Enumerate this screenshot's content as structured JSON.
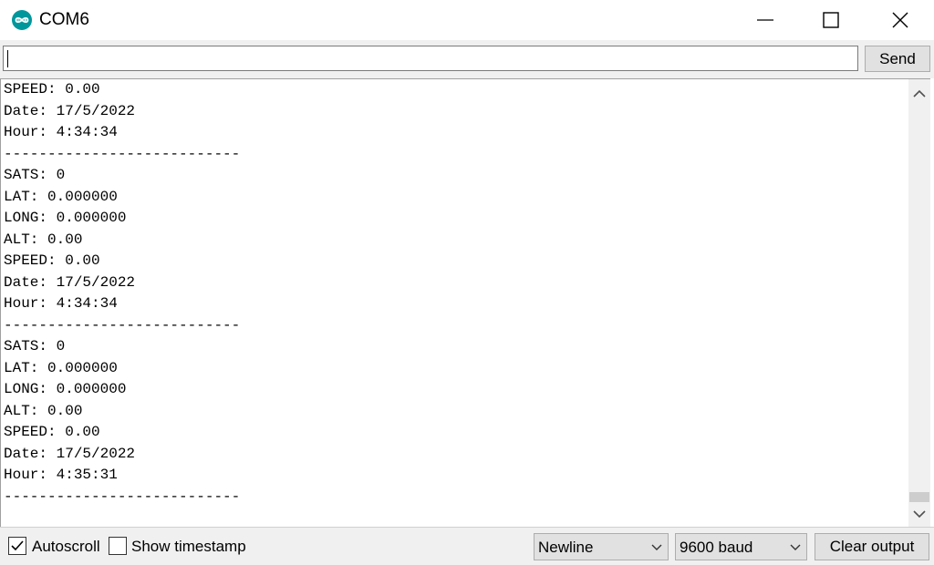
{
  "window": {
    "title": "COM6",
    "app_icon": "arduino-logo-icon",
    "controls": [
      "minimize-icon",
      "maximize-icon",
      "close-icon"
    ]
  },
  "input_bar": {
    "value": "",
    "send_label": "Send"
  },
  "output": {
    "lines": [
      "SPEED: 0.00",
      "Date: 17/5/2022",
      "Hour: 4:34:34",
      "---------------------------",
      "SATS: 0",
      "LAT: 0.000000",
      "LONG: 0.000000",
      "ALT: 0.00",
      "SPEED: 0.00",
      "Date: 17/5/2022",
      "Hour: 4:34:34",
      "---------------------------",
      "SATS: 0",
      "LAT: 0.000000",
      "LONG: 0.000000",
      "ALT: 0.00",
      "SPEED: 0.00",
      "Date: 17/5/2022",
      "Hour: 4:35:31",
      "---------------------------"
    ]
  },
  "bottom_bar": {
    "autoscroll": {
      "label": "Autoscroll",
      "checked": true
    },
    "timestamp": {
      "label": "Show timestamp",
      "checked": false
    },
    "line_ending": "Newline",
    "baud_rate": "9600 baud",
    "clear_label": "Clear output"
  },
  "colors": {
    "accent": "#00979c",
    "chrome_bg": "#f0f0f0",
    "button_bg": "#e1e1e1"
  }
}
